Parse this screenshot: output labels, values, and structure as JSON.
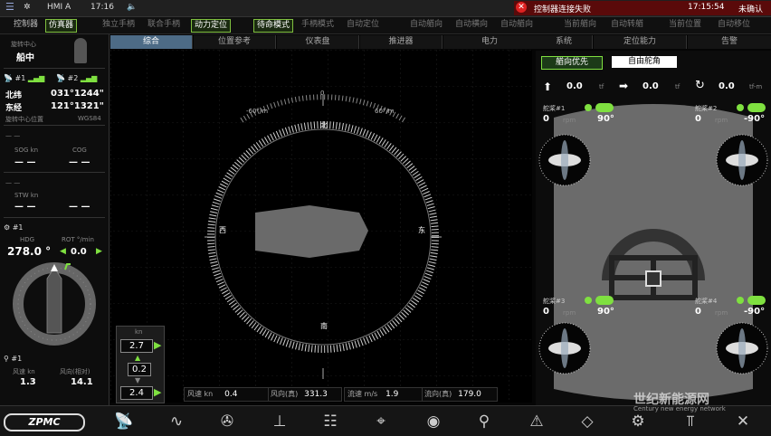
{
  "topbar": {
    "hmi": "HMI A",
    "time_left": "17:16",
    "alarm_text": "控制器连接失败",
    "time_right": "17:15:54",
    "ack": "未确认"
  },
  "modebar": {
    "items": [
      "控制器",
      "仿真器",
      "独立手柄",
      "联合手柄",
      "动力定位",
      "待命模式",
      "手柄模式",
      "自动定位",
      "自动艏向",
      "自动横向",
      "自动艏向",
      "当前艏向",
      "自动转艏",
      "当前位置",
      "自动移位"
    ]
  },
  "tabs": [
    "综合",
    "位置参考",
    "仪表盘",
    "推进器",
    "电力",
    "系统",
    "定位能力",
    "告警"
  ],
  "left": {
    "rot_center_label": "旋转中心",
    "rot_center_value": "船中",
    "gps1": "#1",
    "gps2": "#2",
    "lat_label": "北纬",
    "lat_value": "031°1244\"",
    "lon_label": "东经",
    "lon_value": "121°1321\"",
    "pos_label": "旋转中心位置",
    "datum": "WGS84",
    "dash1": "— —",
    "sog_label": "SOG kn",
    "sog_value": "— —",
    "cog_label": "COG",
    "cog_value": "— —",
    "dash2": "— —",
    "stw_label": "STW kn",
    "stw_value": "— —",
    "stw_value2": "— —",
    "gyro": "#1",
    "hdg_label": "HDG",
    "hdg_value": "278.0 °",
    "rot_label": "ROT °/min",
    "rot_value": "0.0",
    "wind_sensor": "#1",
    "wind_speed_label": "风速 kn",
    "wind_speed_value": "1.3",
    "wind_dir_label": "风向(相对)",
    "wind_dir_value": "14.1"
  },
  "compass": {
    "north": "北",
    "east": "东",
    "south": "南",
    "west": "西",
    "top_zero": "0",
    "left_tick": "-60°/m",
    "right_tick": "60°/m"
  },
  "stepper": {
    "unit": "kn",
    "top": "2.7",
    "mid": "0.2",
    "bottom": "2.4"
  },
  "status": {
    "wind_speed_label": "风速 kn",
    "wind_speed": "0.4",
    "wind_dir_label": "风向(真)",
    "wind_dir": "331.3",
    "current_label": "流速 m/s",
    "current": "1.9",
    "current_dir_label": "流向(真)",
    "current_dir": "179.0"
  },
  "right": {
    "btn_heading": "艏向优先",
    "btn_free": "自由舵角",
    "fx_value": "0.0",
    "fx_unit": "tf",
    "fy_value": "0.0",
    "fy_unit": "tf",
    "mz_value": "0.0",
    "mz_unit": "tf-m",
    "thrusters": [
      {
        "name": "舵桨#1",
        "rpm": "0",
        "rpm_unit": "rpm",
        "angle": "90°"
      },
      {
        "name": "舵桨#2",
        "rpm": "0",
        "rpm_unit": "rpm",
        "angle": "-90°"
      },
      {
        "name": "舵桨#3",
        "rpm": "0",
        "rpm_unit": "rpm",
        "angle": "90°"
      },
      {
        "name": "舵桨#4",
        "rpm": "0",
        "rpm_unit": "rpm",
        "angle": "-90°"
      }
    ]
  },
  "bottom": {
    "logo": "ZPMC",
    "watermark": "世纪新能源网",
    "watermark_sub": "Century new energy network"
  },
  "colors": {
    "accent_green": "#7fe040",
    "tab_active": "#4d6b86",
    "alarm": "#5a0a0a"
  }
}
